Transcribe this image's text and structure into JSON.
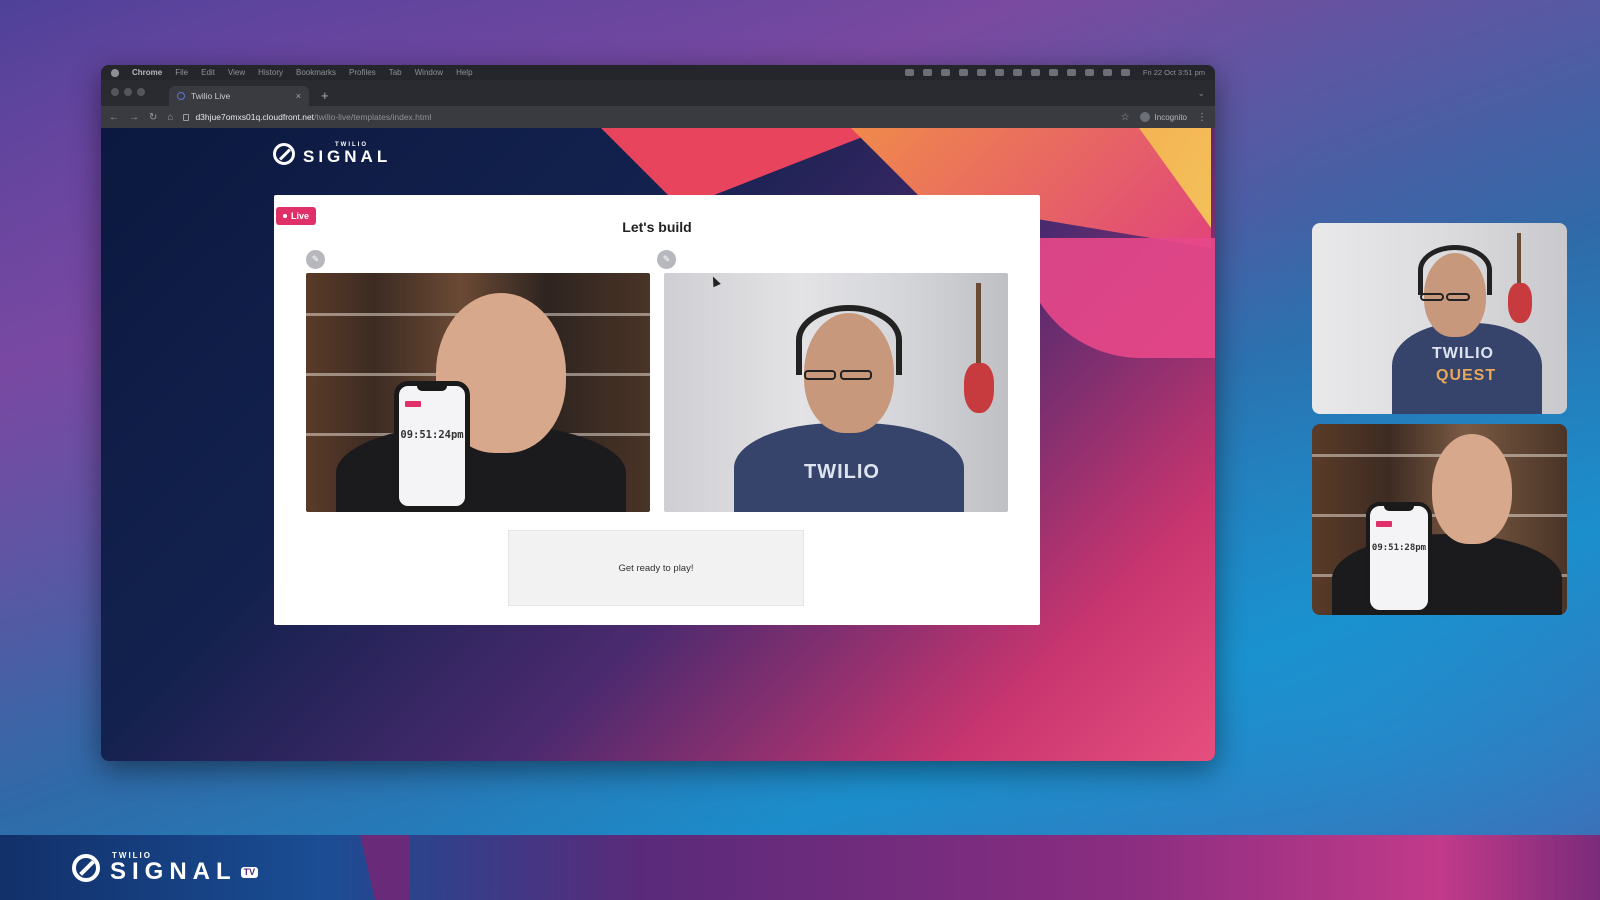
{
  "menubar": {
    "app": "Chrome",
    "items": [
      "File",
      "Edit",
      "View",
      "History",
      "Bookmarks",
      "Profiles",
      "Tab",
      "Window",
      "Help"
    ],
    "clock": "Fri 22 Oct 3:51 pm"
  },
  "tab": {
    "label": "Twilio Live",
    "close": "×",
    "new_tab": "+"
  },
  "address": {
    "host": "d3hjue7omxs01q.cloudfront.net",
    "path": "/twilio-live/templates/index.html",
    "incognito_label": "Incognito"
  },
  "page": {
    "logo_small": "TWILIO",
    "logo_big": "SIGNAL",
    "live_badge": "Live",
    "title": "Let's build",
    "ready_text": "Get ready to play!",
    "phone_time_left": "09:51:24pm",
    "tee_text": "TWILIO"
  },
  "tiles": {
    "phone_time": "09:51:28pm",
    "tee_text_1": "TWILIO",
    "tee_text_2": "QUEST"
  },
  "bottom": {
    "logo_small": "TWILIO",
    "logo_big": "SIGNAL",
    "tv_badge": "TV"
  },
  "colors": {
    "live": "#e0306a",
    "page_bg_dark": "#0b1940",
    "accent_pink": "#e64f7e"
  }
}
